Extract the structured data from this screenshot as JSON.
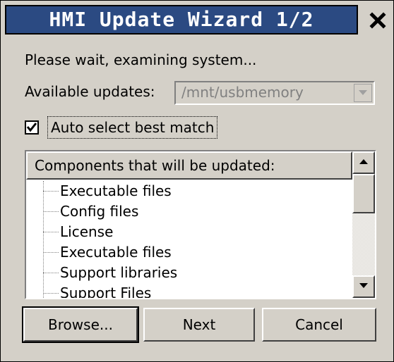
{
  "window": {
    "title": "HMI Update Wizard 1/2",
    "title_bar_color": "#2b4a82"
  },
  "close_icon": "close-icon",
  "status": {
    "text": "Please wait, examining system..."
  },
  "updates": {
    "label": "Available updates:",
    "selected_value": "/mnt/usbmemory",
    "disabled": true
  },
  "auto_select": {
    "label": "Auto select best match",
    "checked": true
  },
  "components": {
    "header": "Components that will be updated:",
    "items": [
      "Executable files",
      "Config files",
      "License",
      "Executable files",
      "Support libraries",
      "Support Files"
    ]
  },
  "buttons": {
    "browse": "Browse...",
    "next": "Next",
    "cancel": "Cancel"
  }
}
